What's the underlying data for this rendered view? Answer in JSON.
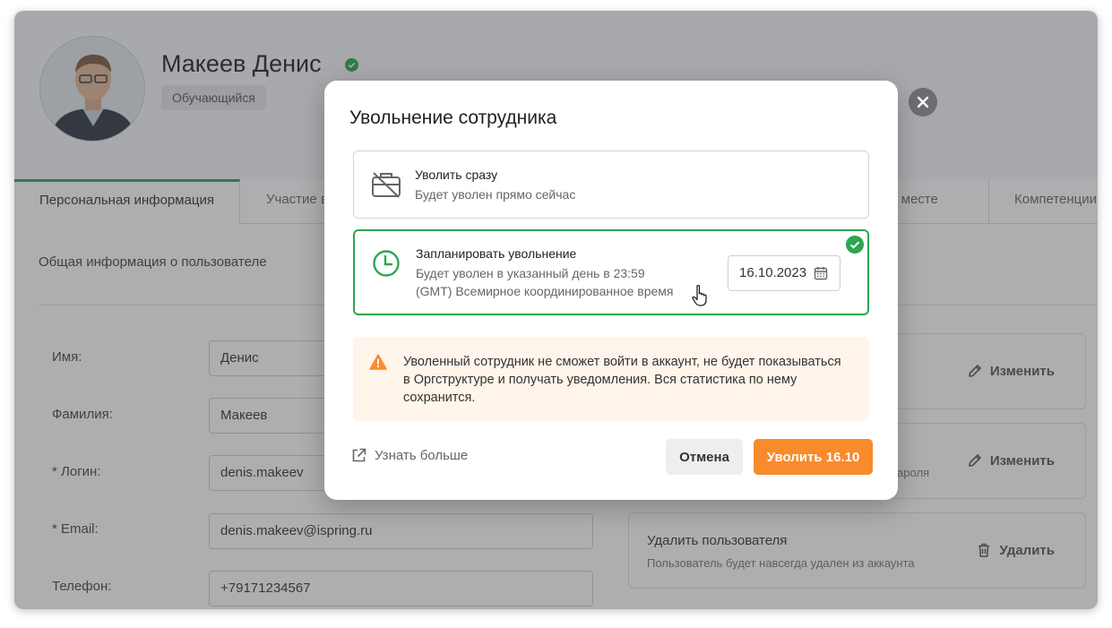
{
  "profile": {
    "name": "Макеев Денис",
    "role": "Обучающийся"
  },
  "tabs": [
    {
      "label": "Персональная информация",
      "active": true
    },
    {
      "label": "Участие в",
      "active": false
    },
    {
      "label": "чем месте",
      "active": false
    },
    {
      "label": "Компетенции",
      "active": false
    }
  ],
  "section": {
    "title": "Общая информация о пользователе"
  },
  "fields": {
    "first_name": {
      "label": "Имя:",
      "value": "Денис"
    },
    "last_name": {
      "label": "Фамилия:",
      "value": "Макеев"
    },
    "login": {
      "label": "*  Логин:",
      "value": "denis.makeev"
    },
    "email": {
      "label": "*  Email:",
      "value": "denis.makeev@ispring.ru"
    },
    "phone": {
      "label": "Телефон:",
      "value": "+79171234567"
    }
  },
  "side_panels": {
    "edit1": {
      "action": "Изменить"
    },
    "edit2": {
      "desc_fragment": "пароля",
      "action": "Изменить"
    },
    "delete": {
      "title": "Удалить пользователя",
      "desc": "Пользователь будет навсегда удален из аккаунта",
      "action": "Удалить"
    }
  },
  "modal": {
    "title": "Увольнение сотрудника",
    "option_now": {
      "title": "Уволить сразу",
      "desc": "Будет уволен прямо сейчас"
    },
    "option_scheduled": {
      "title": "Запланировать увольнение",
      "desc_line1": "Будет уволен в указанный день в 23:59",
      "desc_line2": "(GMT) Всемирное координированное время",
      "date": "16.10.2023"
    },
    "warning": "Уволенный сотрудник не сможет войти в аккаунт, не будет показываться в Оргструктуре и получать уведомления. Вся статистика по нему сохранится.",
    "learn_more": "Узнать больше",
    "cancel": "Отмена",
    "confirm": "Уволить 16.10"
  },
  "colors": {
    "accent_green": "#2da651",
    "accent_orange": "#f88b2c",
    "warning_bg": "#fff5ea"
  }
}
